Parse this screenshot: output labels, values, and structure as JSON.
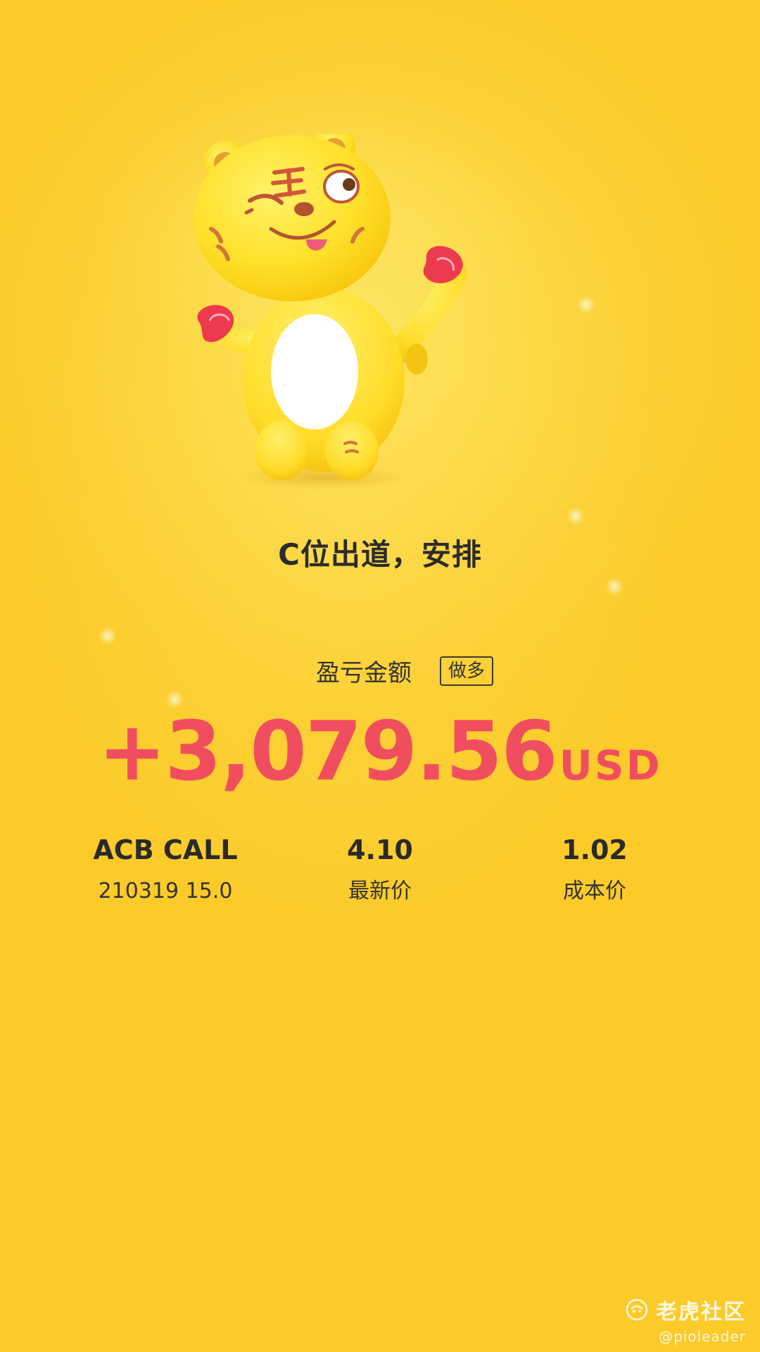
{
  "slogan": "C位出道，安排",
  "pnl": {
    "label": "盈亏金额",
    "direction_badge": "做多",
    "amount": "+3,079.56",
    "currency": "USD",
    "amount_color": "#f04e5e"
  },
  "position": {
    "symbol": "ACB CALL",
    "contract": "210319 15.0",
    "latest_price": "4.10",
    "latest_price_label": "最新价",
    "cost_price": "1.02",
    "cost_price_label": "成本价"
  },
  "watermark": {
    "brand": "老虎社区",
    "user": "@pioleader",
    "logo_icon": "tiger-logo-icon"
  },
  "mascot": {
    "icon": "tiger-mascot-icon"
  },
  "colors": {
    "background": "#fcd43a",
    "text_dark": "#2b2b2b"
  }
}
